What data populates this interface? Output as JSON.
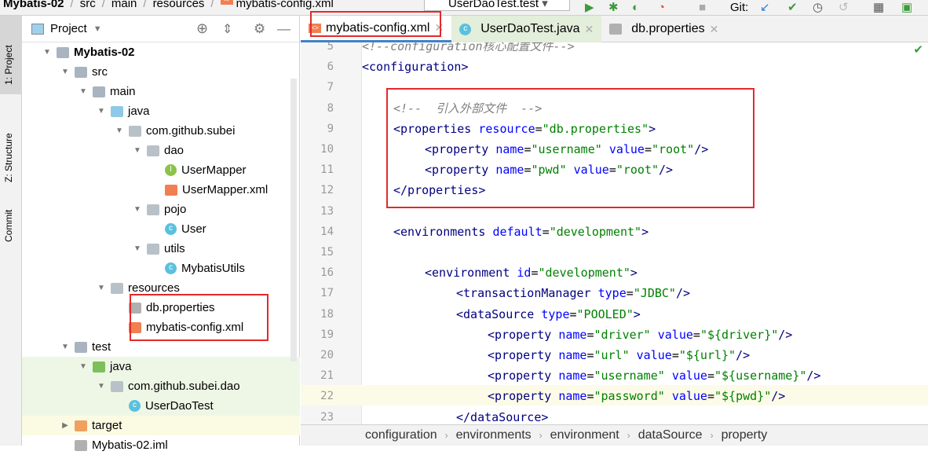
{
  "breadcrumb": [
    "Mybatis-02",
    "src",
    "main",
    "resources",
    "mybatis-config.xml"
  ],
  "run_config": "UserDaoTest.test",
  "toolbar": {
    "git_label": "Git:"
  },
  "left_strip": [
    "1: Project",
    "Z: Structure",
    "Commit"
  ],
  "project_panel": {
    "title": "Project"
  },
  "tree": [
    {
      "label": "Mybatis-02",
      "depth": 0,
      "icon": "module-folder",
      "open": true,
      "bold": true
    },
    {
      "label": "src",
      "depth": 1,
      "icon": "folder",
      "open": true
    },
    {
      "label": "main",
      "depth": 2,
      "icon": "folder",
      "open": true
    },
    {
      "label": "java",
      "depth": 3,
      "icon": "source-folder",
      "open": true
    },
    {
      "label": "com.github.subei",
      "depth": 4,
      "icon": "package",
      "open": true
    },
    {
      "label": "dao",
      "depth": 5,
      "icon": "package",
      "open": true
    },
    {
      "label": "UserMapper",
      "depth": 6,
      "icon": "interface"
    },
    {
      "label": "UserMapper.xml",
      "depth": 6,
      "icon": "xml"
    },
    {
      "label": "pojo",
      "depth": 5,
      "icon": "package",
      "open": true
    },
    {
      "label": "User",
      "depth": 6,
      "icon": "class"
    },
    {
      "label": "utils",
      "depth": 5,
      "icon": "package",
      "open": true
    },
    {
      "label": "MybatisUtils",
      "depth": 6,
      "icon": "class"
    },
    {
      "label": "resources",
      "depth": 3,
      "icon": "resources-folder",
      "open": true
    },
    {
      "label": "db.properties",
      "depth": 4,
      "icon": "properties"
    },
    {
      "label": "mybatis-config.xml",
      "depth": 4,
      "icon": "xml"
    },
    {
      "label": "test",
      "depth": 1,
      "icon": "folder",
      "open": true
    },
    {
      "label": "java",
      "depth": 2,
      "icon": "test-folder",
      "open": true
    },
    {
      "label": "com.github.subei.dao",
      "depth": 3,
      "icon": "package",
      "open": true
    },
    {
      "label": "UserDaoTest",
      "depth": 4,
      "icon": "test-class"
    },
    {
      "label": "target",
      "depth": 1,
      "icon": "excluded-folder",
      "open": false
    },
    {
      "label": "Mybatis-02.iml",
      "depth": 1,
      "icon": "iml"
    }
  ],
  "tabs": [
    {
      "label": "mybatis-config.xml",
      "active": true
    },
    {
      "label": "UserDaoTest.java"
    },
    {
      "label": "db.properties"
    }
  ],
  "code": [
    {
      "n": "5",
      "parts": [
        [
          "c",
          "<!--configuration核心配置文件-->"
        ]
      ],
      "indent": 0
    },
    {
      "n": "6",
      "parts": [
        [
          "t",
          "<configuration"
        ],
        [
          "t",
          ">"
        ]
      ],
      "indent": 0
    },
    {
      "n": "7",
      "parts": [],
      "indent": 0
    },
    {
      "n": "8",
      "parts": [
        [
          "c",
          "<!--  引入外部文件  -->"
        ]
      ],
      "indent": 1
    },
    {
      "n": "9",
      "parts": [
        [
          "t",
          "<properties "
        ],
        [
          "a",
          "resource"
        ],
        [
          "p",
          "="
        ],
        [
          "v",
          "\"db.properties\""
        ],
        [
          "t",
          ">"
        ]
      ],
      "indent": 1
    },
    {
      "n": "10",
      "parts": [
        [
          "t",
          "<property "
        ],
        [
          "a",
          "name"
        ],
        [
          "p",
          "="
        ],
        [
          "v",
          "\"username\" "
        ],
        [
          "a",
          "value"
        ],
        [
          "p",
          "="
        ],
        [
          "v",
          "\"root\""
        ],
        [
          "t",
          "/>"
        ]
      ],
      "indent": 2
    },
    {
      "n": "11",
      "parts": [
        [
          "t",
          "<property "
        ],
        [
          "a",
          "name"
        ],
        [
          "p",
          "="
        ],
        [
          "v",
          "\"pwd\" "
        ],
        [
          "a",
          "value"
        ],
        [
          "p",
          "="
        ],
        [
          "v",
          "\"root\""
        ],
        [
          "t",
          "/>"
        ]
      ],
      "indent": 2
    },
    {
      "n": "12",
      "parts": [
        [
          "t",
          "</properties>"
        ]
      ],
      "indent": 1
    },
    {
      "n": "13",
      "parts": [],
      "indent": 0
    },
    {
      "n": "14",
      "parts": [
        [
          "t",
          "<environments "
        ],
        [
          "a",
          "default"
        ],
        [
          "p",
          "="
        ],
        [
          "v",
          "\"development\""
        ],
        [
          "t",
          ">"
        ]
      ],
      "indent": 1
    },
    {
      "n": "15",
      "parts": [],
      "indent": 0
    },
    {
      "n": "16",
      "parts": [
        [
          "t",
          "<environment "
        ],
        [
          "a",
          "id"
        ],
        [
          "p",
          "="
        ],
        [
          "v",
          "\"development\""
        ],
        [
          "t",
          ">"
        ]
      ],
      "indent": 2
    },
    {
      "n": "17",
      "parts": [
        [
          "t",
          "<transactionManager "
        ],
        [
          "a",
          "type"
        ],
        [
          "p",
          "="
        ],
        [
          "v",
          "\"JDBC\""
        ],
        [
          "t",
          "/>"
        ]
      ],
      "indent": 3
    },
    {
      "n": "18",
      "parts": [
        [
          "t",
          "<dataSource "
        ],
        [
          "a",
          "type"
        ],
        [
          "p",
          "="
        ],
        [
          "v",
          "\"POOLED\""
        ],
        [
          "t",
          ">"
        ]
      ],
      "indent": 3
    },
    {
      "n": "19",
      "parts": [
        [
          "t",
          "<property "
        ],
        [
          "a",
          "name"
        ],
        [
          "p",
          "="
        ],
        [
          "v",
          "\"driver\" "
        ],
        [
          "a",
          "value"
        ],
        [
          "p",
          "="
        ],
        [
          "v",
          "\"${driver}\""
        ],
        [
          "t",
          "/>"
        ]
      ],
      "indent": 4
    },
    {
      "n": "20",
      "parts": [
        [
          "t",
          "<property "
        ],
        [
          "a",
          "name"
        ],
        [
          "p",
          "="
        ],
        [
          "v",
          "\"url\" "
        ],
        [
          "a",
          "value"
        ],
        [
          "p",
          "="
        ],
        [
          "v",
          "\"${url}\""
        ],
        [
          "t",
          "/>"
        ]
      ],
      "indent": 4
    },
    {
      "n": "21",
      "parts": [
        [
          "t",
          "<property "
        ],
        [
          "a",
          "name"
        ],
        [
          "p",
          "="
        ],
        [
          "v",
          "\"username\" "
        ],
        [
          "a",
          "value"
        ],
        [
          "p",
          "="
        ],
        [
          "v",
          "\"${username}\""
        ],
        [
          "t",
          "/>"
        ]
      ],
      "indent": 4
    },
    {
      "n": "22",
      "parts": [
        [
          "t",
          "<property "
        ],
        [
          "a",
          "name"
        ],
        [
          "p",
          "="
        ],
        [
          "v",
          "\"password\" "
        ],
        [
          "a",
          "value"
        ],
        [
          "p",
          "="
        ],
        [
          "v",
          "\"${pwd}\""
        ],
        [
          "t",
          "/>"
        ]
      ],
      "indent": 4
    },
    {
      "n": "23",
      "parts": [
        [
          "t",
          "</dataSource>"
        ]
      ],
      "indent": 3
    }
  ],
  "status_path": [
    "configuration",
    "environments",
    "environment",
    "dataSource",
    "property"
  ]
}
